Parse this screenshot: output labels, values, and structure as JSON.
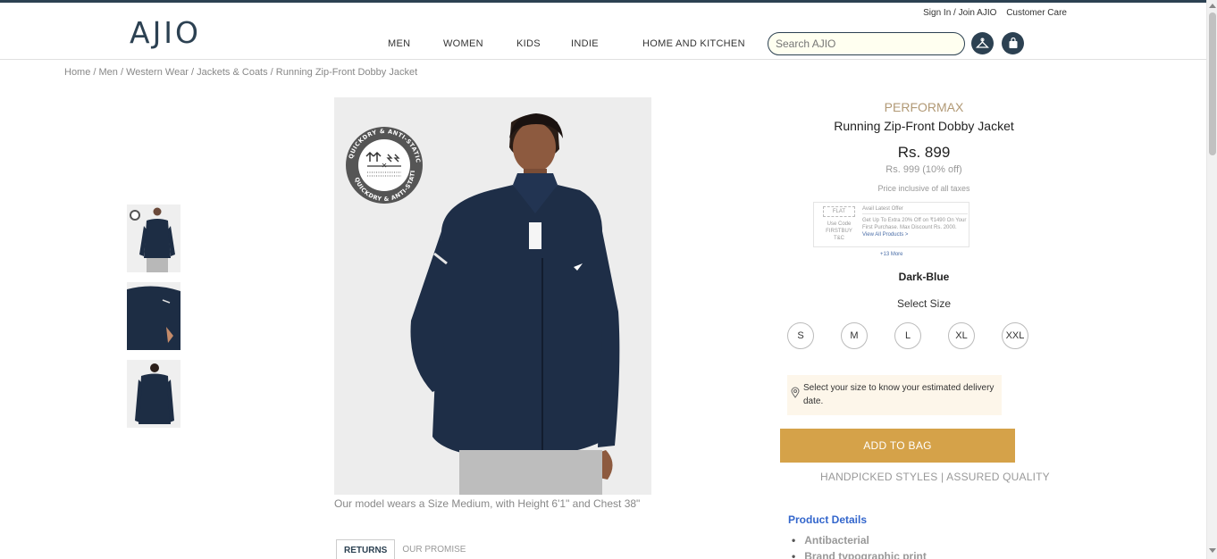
{
  "header": {
    "logo": "AJIO",
    "toplinks": [
      "Sign In / Join AJIO",
      "Customer Care"
    ],
    "nav": [
      "MEN",
      "WOMEN",
      "KIDS",
      "INDIE",
      "HOME AND KITCHEN"
    ],
    "search_placeholder": "Search AJIO",
    "icons": [
      "wishlist-icon",
      "bag-icon"
    ]
  },
  "breadcrumb": "Home / Men / Western Wear / Jackets & Coats / Running Zip-Front Dobby Jacket",
  "gallery": {
    "badge_text": "QUICKDRY & ANTI-STATIC",
    "caption": "Our model wears a Size Medium, with Height 6'1\" and Chest 38\"",
    "thumbnails": [
      "front view",
      "side view",
      "back view"
    ]
  },
  "tabs": [
    "RETURNS",
    "OUR PROMISE"
  ],
  "product": {
    "brand": "PERFORMAX",
    "name": "Running Zip-Front Dobby Jacket",
    "price": "Rs. 899",
    "mrp": "Rs. 999 (10% off)",
    "tax_note": "Price inclusive of all taxes",
    "offer": {
      "label": "Use Code",
      "code": "FIRSTBUY",
      "tc": "T&C",
      "heading": "Avail Latest Offer",
      "text": "Get Up To Extra 20% Off on ₹1490 On Your First Purchase. Max Discount Rs. 2000.",
      "link": "View All Products >",
      "more": "+13 More"
    },
    "color": "Dark-Blue",
    "select_size_label": "Select Size",
    "sizes": [
      "S",
      "M",
      "L",
      "XL",
      "XXL"
    ],
    "delivery_text": "Select your size to know your estimated delivery date.",
    "add_to_bag": "ADD TO BAG",
    "assurance": "HANDPICKED STYLES | ASSURED QUALITY",
    "details_title": "Product Details",
    "details": [
      "Antibacterial",
      "Brand typographic print"
    ]
  },
  "colors": {
    "brand_navy": "#2c4152",
    "accent_gold": "#d5a249",
    "brand_text": "#b19975",
    "link_blue": "#3366cc",
    "delivery_bg": "#fdf6ea"
  }
}
